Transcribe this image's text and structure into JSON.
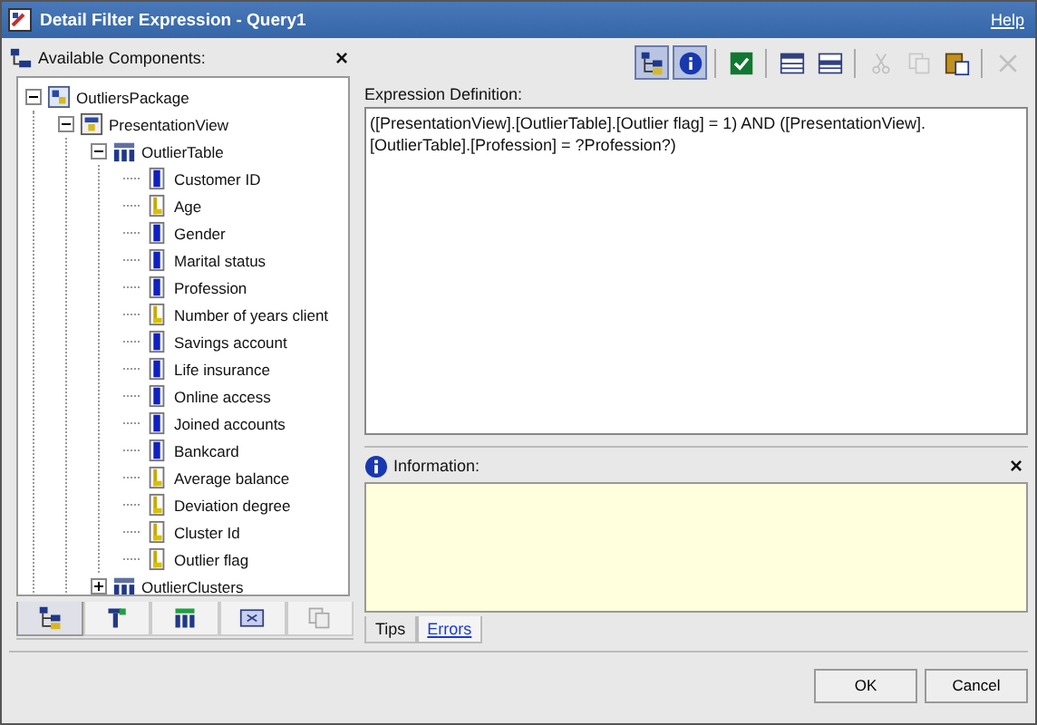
{
  "window": {
    "title": "Detail Filter Expression - Query1",
    "help": "Help"
  },
  "components_panel": {
    "title": "Available Components:",
    "close": "×"
  },
  "tree": [
    {
      "label": "OutliersPackage",
      "kind": "package",
      "expanded": true,
      "children": [
        {
          "label": "PresentationView",
          "kind": "view",
          "expanded": true,
          "children": [
            {
              "label": "OutlierTable",
              "kind": "table",
              "expanded": true,
              "children": [
                {
                  "label": "Customer ID",
                  "kind": "attribute"
                },
                {
                  "label": "Age",
                  "kind": "measure"
                },
                {
                  "label": "Gender",
                  "kind": "attribute"
                },
                {
                  "label": "Marital status",
                  "kind": "attribute"
                },
                {
                  "label": "Profession",
                  "kind": "attribute"
                },
                {
                  "label": "Number of years client",
                  "kind": "measure"
                },
                {
                  "label": "Savings account",
                  "kind": "attribute"
                },
                {
                  "label": "Life insurance",
                  "kind": "attribute"
                },
                {
                  "label": "Online access",
                  "kind": "attribute"
                },
                {
                  "label": "Joined accounts",
                  "kind": "attribute"
                },
                {
                  "label": "Bankcard",
                  "kind": "attribute"
                },
                {
                  "label": "Average balance",
                  "kind": "measure"
                },
                {
                  "label": "Deviation degree",
                  "kind": "measure"
                },
                {
                  "label": "Cluster Id",
                  "kind": "measure"
                },
                {
                  "label": "Outlier flag",
                  "kind": "measure"
                }
              ]
            },
            {
              "label": "OutlierClusters",
              "kind": "table",
              "expanded": false
            }
          ]
        }
      ]
    }
  ],
  "panel_tabs": [
    {
      "kind": "tree",
      "selected": true
    },
    {
      "kind": "query",
      "selected": false
    },
    {
      "kind": "table",
      "selected": false
    },
    {
      "kind": "function",
      "selected": false
    },
    {
      "kind": "copy",
      "selected": false
    }
  ],
  "toolbar": [
    {
      "kind": "tree",
      "selected": true,
      "disabled": false
    },
    {
      "kind": "info",
      "selected": true,
      "disabled": false
    },
    {
      "kind": "sep"
    },
    {
      "kind": "check",
      "selected": false,
      "disabled": false
    },
    {
      "kind": "sep"
    },
    {
      "kind": "grid",
      "selected": false,
      "disabled": false
    },
    {
      "kind": "grid2",
      "selected": false,
      "disabled": false
    },
    {
      "kind": "sep"
    },
    {
      "kind": "cut",
      "selected": false,
      "disabled": true
    },
    {
      "kind": "copy",
      "selected": false,
      "disabled": true
    },
    {
      "kind": "paste",
      "selected": false,
      "disabled": false
    },
    {
      "kind": "sep"
    },
    {
      "kind": "delete",
      "selected": false,
      "disabled": true
    }
  ],
  "expression": {
    "label": "Expression Definition:",
    "value": "([PresentationView].[OutlierTable].[Outlier flag] = 1) AND ([PresentationView].[OutlierTable].[Profession] = ?Profession?)"
  },
  "information": {
    "title": "Information:",
    "close": "×"
  },
  "info_tabs": [
    {
      "label": "Tips",
      "selected": true
    },
    {
      "label": "Errors",
      "selected": false
    }
  ],
  "buttons": [
    "OK",
    "Cancel"
  ]
}
